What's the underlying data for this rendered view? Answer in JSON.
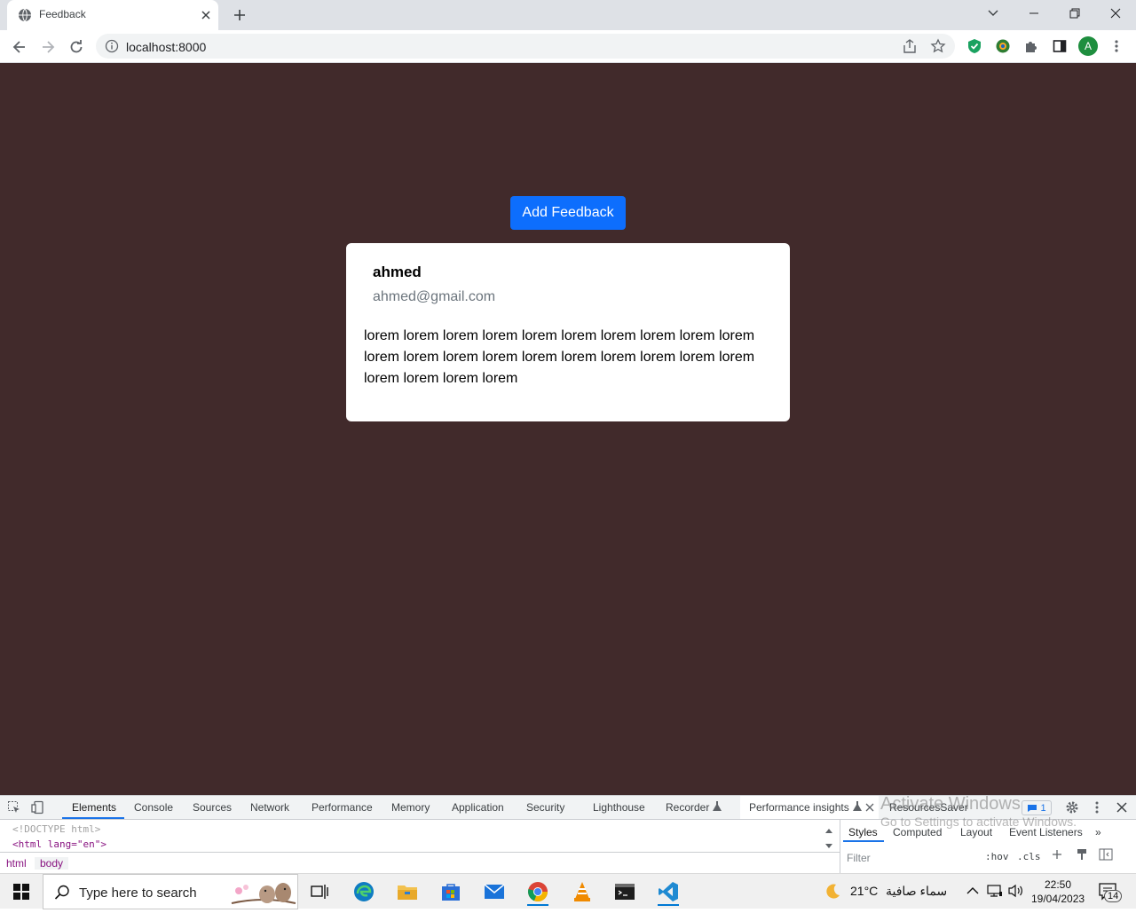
{
  "browser": {
    "tab_title": "Feedback",
    "url": "localhost:8000",
    "profile_initial": "A"
  },
  "page": {
    "add_button_label": "Add Feedback",
    "feedback": {
      "name": "ahmed",
      "email": "ahmed@gmail.com",
      "message": "lorem lorem lorem lorem lorem lorem lorem lorem lorem lorem lorem lorem lorem lorem lorem lorem lorem lorem lorem lorem lorem lorem lorem lorem"
    },
    "colors": {
      "background": "#412a2b",
      "button": "#0d6efd",
      "card": "#ffffff"
    }
  },
  "devtools": {
    "tabs": [
      "Elements",
      "Console",
      "Sources",
      "Network",
      "Performance",
      "Memory",
      "Application",
      "Security",
      "Lighthouse",
      "Recorder",
      "Performance insights",
      "ResourcesSaver"
    ],
    "issues_count": "1",
    "code_lines": [
      "<!DOCTYPE html>",
      "<html lang=\"en\">"
    ],
    "breadcrumbs": [
      "html",
      "body"
    ],
    "styles_tabs": [
      "Styles",
      "Computed",
      "Layout",
      "Event Listeners"
    ],
    "filter_placeholder": "Filter",
    "hov": ":hov",
    "cls": ".cls"
  },
  "watermark": {
    "line1": "Activate Windows",
    "line2": "Go to Settings to activate Windows."
  },
  "taskbar": {
    "search_placeholder": "Type here to search",
    "weather": "21°C",
    "weather_text": "سماء صافية",
    "time": "22:50",
    "date": "19/04/2023",
    "notifications": "14"
  }
}
